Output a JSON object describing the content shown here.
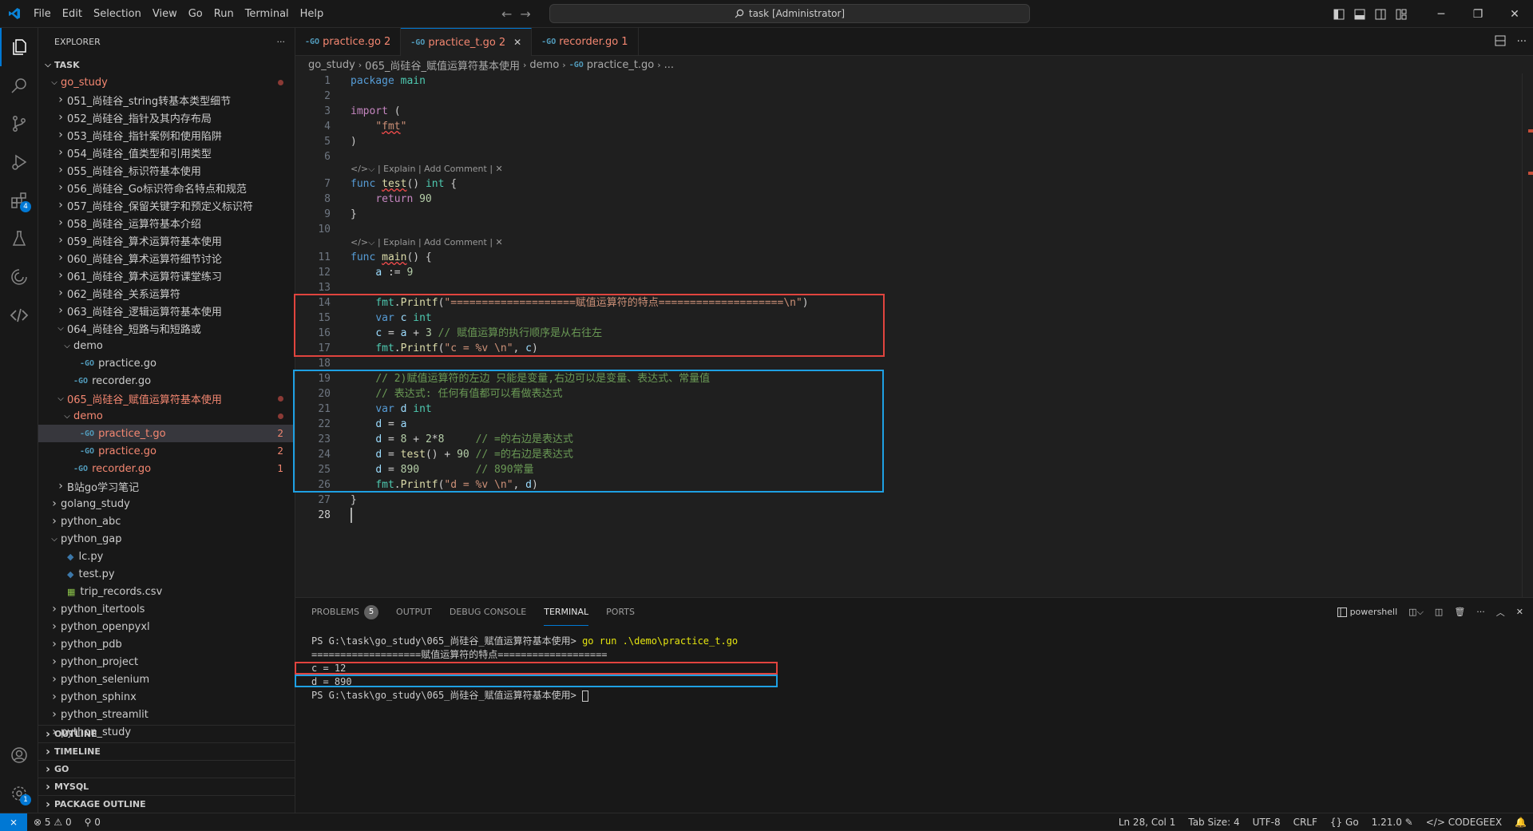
{
  "menu": [
    "File",
    "Edit",
    "Selection",
    "View",
    "Go",
    "Run",
    "Terminal",
    "Help"
  ],
  "command_center": "task [Administrator]",
  "explorer": {
    "title": "EXPLORER",
    "root": "TASK",
    "items": [
      {
        "label": "go_study",
        "indent": 1,
        "chevron": "down",
        "state": "err-dot"
      },
      {
        "label": "051_尚硅谷_string转基本类型细节",
        "indent": 2,
        "chevron": "right",
        "state": ""
      },
      {
        "label": "052_尚硅谷_指针及其内存布局",
        "indent": 2,
        "chevron": "right",
        "state": ""
      },
      {
        "label": "053_尚硅谷_指针案例和使用陷阱",
        "indent": 2,
        "chevron": "right",
        "state": ""
      },
      {
        "label": "054_尚硅谷_值类型和引用类型",
        "indent": 2,
        "chevron": "right",
        "state": ""
      },
      {
        "label": "055_尚硅谷_标识符基本使用",
        "indent": 2,
        "chevron": "right",
        "state": ""
      },
      {
        "label": "056_尚硅谷_Go标识符命名特点和规范",
        "indent": 2,
        "chevron": "right",
        "state": ""
      },
      {
        "label": "057_尚硅谷_保留关键字和预定义标识符",
        "indent": 2,
        "chevron": "right",
        "state": ""
      },
      {
        "label": "058_尚硅谷_运算符基本介绍",
        "indent": 2,
        "chevron": "right",
        "state": ""
      },
      {
        "label": "059_尚硅谷_算术运算符基本使用",
        "indent": 2,
        "chevron": "right",
        "state": ""
      },
      {
        "label": "060_尚硅谷_算术运算符细节讨论",
        "indent": 2,
        "chevron": "right",
        "state": ""
      },
      {
        "label": "061_尚硅谷_算术运算符课堂练习",
        "indent": 2,
        "chevron": "right",
        "state": ""
      },
      {
        "label": "062_尚硅谷_关系运算符",
        "indent": 2,
        "chevron": "right",
        "state": ""
      },
      {
        "label": "063_尚硅谷_逻辑运算符基本使用",
        "indent": 2,
        "chevron": "right",
        "state": ""
      },
      {
        "label": "064_尚硅谷_短路与和短路或",
        "indent": 2,
        "chevron": "down",
        "state": ""
      },
      {
        "label": "demo",
        "indent": 3,
        "chevron": "down",
        "state": ""
      },
      {
        "label": "practice.go",
        "indent": 4,
        "chevron": "",
        "icon": "go",
        "state": ""
      },
      {
        "label": "recorder.go",
        "indent": 3,
        "chevron": "",
        "icon": "go",
        "state": ""
      },
      {
        "label": "065_尚硅谷_赋值运算符基本使用",
        "indent": 2,
        "chevron": "down",
        "state": "err-dot"
      },
      {
        "label": "demo",
        "indent": 3,
        "chevron": "down",
        "state": "err-dot"
      },
      {
        "label": "practice_t.go",
        "indent": 4,
        "chevron": "",
        "icon": "go",
        "state": "err-count",
        "count": "2",
        "selected": true
      },
      {
        "label": "practice.go",
        "indent": 4,
        "chevron": "",
        "icon": "go",
        "state": "err-count",
        "count": "2"
      },
      {
        "label": "recorder.go",
        "indent": 3,
        "chevron": "",
        "icon": "go",
        "state": "err-count",
        "count": "1"
      },
      {
        "label": "B站go学习笔记",
        "indent": 2,
        "chevron": "right",
        "state": ""
      },
      {
        "label": "golang_study",
        "indent": 1,
        "chevron": "right",
        "state": ""
      },
      {
        "label": "python_abc",
        "indent": 1,
        "chevron": "right",
        "state": ""
      },
      {
        "label": "python_gap",
        "indent": 1,
        "chevron": "down",
        "state": ""
      },
      {
        "label": "lc.py",
        "indent": 2,
        "chevron": "",
        "icon": "py",
        "state": ""
      },
      {
        "label": "test.py",
        "indent": 2,
        "chevron": "",
        "icon": "py",
        "state": ""
      },
      {
        "label": "trip_records.csv",
        "indent": 2,
        "chevron": "",
        "icon": "csv",
        "state": ""
      },
      {
        "label": "python_itertools",
        "indent": 1,
        "chevron": "right",
        "state": ""
      },
      {
        "label": "python_openpyxl",
        "indent": 1,
        "chevron": "right",
        "state": ""
      },
      {
        "label": "python_pdb",
        "indent": 1,
        "chevron": "right",
        "state": ""
      },
      {
        "label": "python_project",
        "indent": 1,
        "chevron": "right",
        "state": ""
      },
      {
        "label": "python_selenium",
        "indent": 1,
        "chevron": "right",
        "state": ""
      },
      {
        "label": "python_sphinx",
        "indent": 1,
        "chevron": "right",
        "state": ""
      },
      {
        "label": "python_streamlit",
        "indent": 1,
        "chevron": "right",
        "state": ""
      },
      {
        "label": "python_study",
        "indent": 1,
        "chevron": "right",
        "state": ""
      }
    ],
    "sections": [
      "OUTLINE",
      "TIMELINE",
      "GO",
      "MYSQL",
      "PACKAGE OUTLINE"
    ]
  },
  "tabs": [
    {
      "label": "practice.go",
      "badge": "2",
      "active": false
    },
    {
      "label": "practice_t.go",
      "badge": "2",
      "active": true
    },
    {
      "label": "recorder.go",
      "badge": "1",
      "active": false
    }
  ],
  "breadcrumb": [
    "go_study",
    "065_尚硅谷_赋值运算符基本使用",
    "demo",
    "practice_t.go",
    "..."
  ],
  "codelens": "| Explain | Add Comment |",
  "current_line": "28",
  "panel": {
    "tabs": [
      "PROBLEMS",
      "OUTPUT",
      "DEBUG CONSOLE",
      "TERMINAL",
      "PORTS"
    ],
    "problems_count": "5",
    "active_tab": "TERMINAL",
    "shell": "powershell",
    "terminal": {
      "prompt1": "PS G:\\task\\go_study\\065_尚硅谷_赋值运算符基本使用> ",
      "cmd": "go run .\\demo\\practice_t.go",
      "out1": "===================赋值运算符的特点===================",
      "out2": "c = 12",
      "out3": "d = 890",
      "prompt2": "PS G:\\task\\go_study\\065_尚硅谷_赋值运算符基本使用> "
    }
  },
  "status": {
    "errors": "5",
    "warnings": "0",
    "ports": "0",
    "position": "Ln 28, Col 1",
    "tab_size": "Tab Size: 4",
    "encoding": "UTF-8",
    "eol": "CRLF",
    "language": "Go",
    "go_version": "1.21.0",
    "ext": "CODEGEEX"
  },
  "colors": {
    "accent": "#0078d4",
    "error": "#f48771",
    "box_red": "#e0443e",
    "box_blue": "#1ea0e3"
  }
}
